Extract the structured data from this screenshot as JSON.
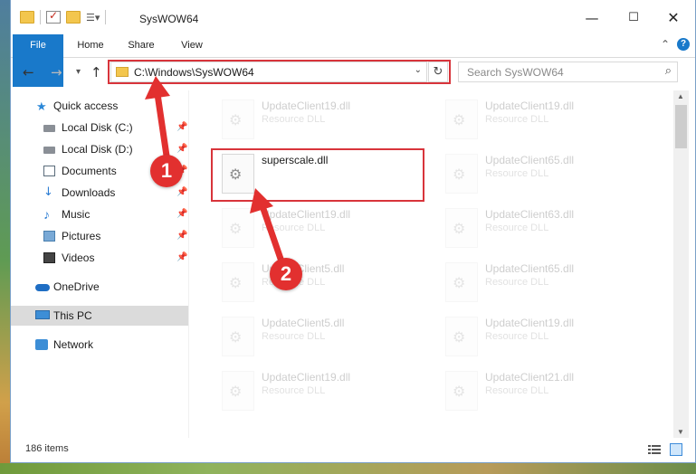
{
  "window": {
    "title": "SysWOW64",
    "controls": {
      "minimize": "—",
      "maximize": "☐",
      "close": "✕"
    }
  },
  "ribbon": {
    "tabs": [
      {
        "label": "File",
        "active": true
      },
      {
        "label": "Home"
      },
      {
        "label": "Share"
      },
      {
        "label": "View"
      }
    ],
    "collapse_icon": "chevron-up-icon",
    "help_icon": "help-icon"
  },
  "navigation": {
    "address": "C:\\Windows\\SysWOW64",
    "search_placeholder": "Search SysWOW64"
  },
  "sidebar": {
    "items": [
      {
        "label": "Quick access",
        "icon": "star-icon"
      },
      {
        "label": "Local Disk (C:)",
        "icon": "disk-icon",
        "pinned": true
      },
      {
        "label": "Local Disk (D:)",
        "icon": "disk-icon",
        "pinned": true
      },
      {
        "label": "Documents",
        "icon": "documents-icon",
        "pinned": true
      },
      {
        "label": "Downloads",
        "icon": "downloads-icon",
        "pinned": true
      },
      {
        "label": "Music",
        "icon": "music-icon",
        "pinned": true
      },
      {
        "label": "Pictures",
        "icon": "pictures-icon",
        "pinned": true
      },
      {
        "label": "Videos",
        "icon": "videos-icon",
        "pinned": true
      },
      {
        "label": "OneDrive",
        "icon": "cloud-icon"
      },
      {
        "label": "This PC",
        "icon": "pc-icon",
        "selected": true
      },
      {
        "label": "Network",
        "icon": "network-icon"
      }
    ]
  },
  "files": {
    "left_column": [
      {
        "name": "UpdateClient19.dll",
        "type": "Resource DLL"
      },
      {
        "name": "superscale.dll",
        "type": ""
      },
      {
        "name": "UpdateClient19.dll",
        "type": "Resource DLL"
      },
      {
        "name": "UpdateClient5.dll",
        "type": "Resource DLL"
      },
      {
        "name": "UpdateClient5.dll",
        "type": "Resource DLL"
      },
      {
        "name": "UpdateClient19.dll",
        "type": "Resource DLL"
      }
    ],
    "right_column": [
      {
        "name": "UpdateClient19.dll",
        "type": "Resource DLL"
      },
      {
        "name": "UpdateClient65.dll",
        "type": "Resource DLL"
      },
      {
        "name": "UpdateClient63.dll",
        "type": "Resource DLL"
      },
      {
        "name": "UpdateClient65.dll",
        "type": "Resource DLL"
      },
      {
        "name": "UpdateClient19.dll",
        "type": "Resource DLL"
      },
      {
        "name": "UpdateClient21.dll",
        "type": "Resource DLL"
      }
    ]
  },
  "status": {
    "item_count": "186 items"
  },
  "callouts": {
    "step1": "1",
    "step2": "2",
    "color": "#e2302f"
  }
}
